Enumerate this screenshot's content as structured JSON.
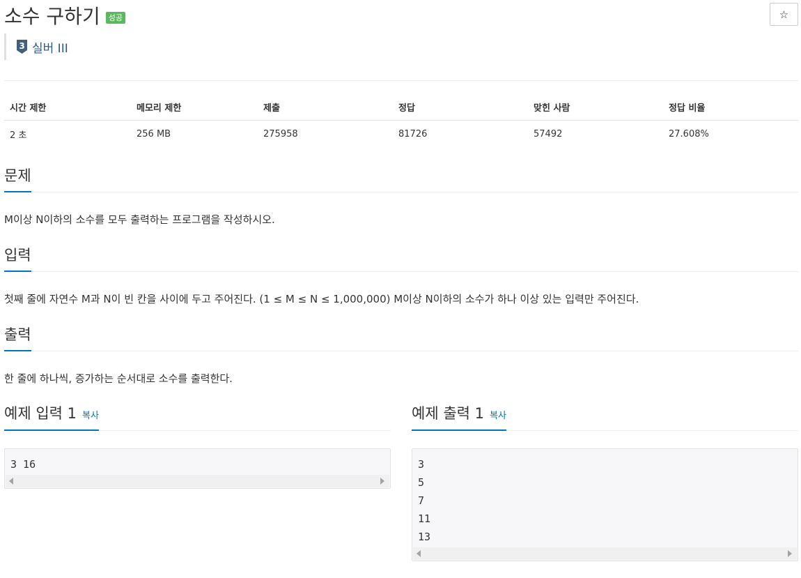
{
  "problem": {
    "title": "소수 구하기",
    "status_badge": "성공",
    "star_icon": "☆",
    "tier_icon": "silver-3-tier-icon",
    "tier_number": "3",
    "tier_label": "실버 III"
  },
  "info_table": {
    "headers": [
      "시간 제한",
      "메모리 제한",
      "제출",
      "정답",
      "맞힌 사람",
      "정답 비율"
    ],
    "values": [
      "2 초",
      "256 MB",
      "275958",
      "81726",
      "57492",
      "27.608%"
    ]
  },
  "sections": {
    "description": {
      "heading": "문제",
      "text": "M이상 N이하의 소수를 모두 출력하는 프로그램을 작성하시오."
    },
    "input": {
      "heading": "입력",
      "text": "첫째 줄에 자연수 M과 N이 빈 칸을 사이에 두고 주어진다. (1 ≤ M ≤ N ≤ 1,000,000) M이상 N이하의 소수가 하나 이상 있는 입력만 주어진다."
    },
    "output": {
      "heading": "출력",
      "text": "한 줄에 하나씩, 증가하는 순서대로 소수를 출력한다."
    }
  },
  "samples": {
    "input": {
      "heading": "예제 입력 1",
      "copy_label": "복사",
      "content": "3 16"
    },
    "output": {
      "heading": "예제 출력 1",
      "copy_label": "복사",
      "content": "3\n5\n7\n11\n13"
    }
  },
  "colors": {
    "accent": "#0076c0",
    "success": "#5cb85c",
    "tier_silver": "#435f7a"
  }
}
